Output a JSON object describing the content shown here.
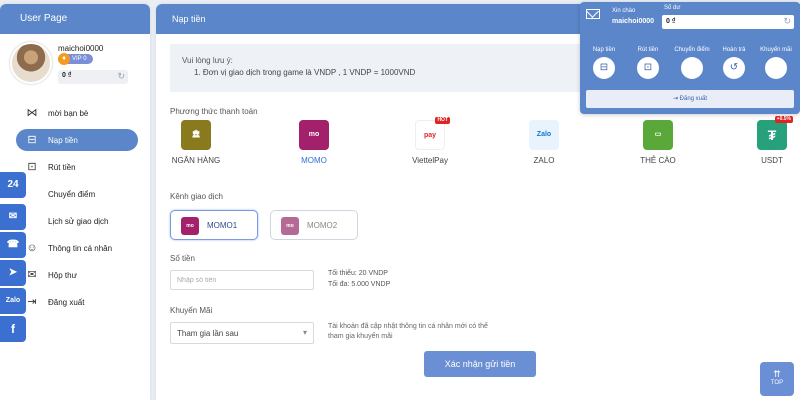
{
  "sidebar": {
    "title": "User Page",
    "username": "maichoi0000",
    "vip_label": "VIP 0",
    "balance": "0 ₫",
    "menu": [
      {
        "label": "mời bạn bè",
        "icon": "share-icon"
      },
      {
        "label": "Nạp tiền",
        "icon": "deposit-icon"
      },
      {
        "label": "Rút tiền",
        "icon": "withdraw-icon"
      },
      {
        "label": "Chuyển điểm",
        "icon": "transfer-icon"
      },
      {
        "label": "Lịch sử giao dịch",
        "icon": "history-icon"
      },
      {
        "label": "Thông tin cá nhân",
        "icon": "user-icon"
      },
      {
        "label": "Hộp thư",
        "icon": "mailbox-icon"
      },
      {
        "label": "Đăng xuất",
        "icon": "logout-icon"
      }
    ],
    "active_index": 1
  },
  "social": [
    {
      "label": "24",
      "icon": "support-24h-icon"
    },
    {
      "label": "✉",
      "icon": "mail-icon"
    },
    {
      "label": "☎",
      "icon": "phone-icon"
    },
    {
      "label": "➤",
      "icon": "telegram-icon"
    },
    {
      "label": "Zalo",
      "icon": "zalo-icon"
    },
    {
      "label": "f",
      "icon": "facebook-icon"
    }
  ],
  "main": {
    "title": "Nạp tiền",
    "notice_title": "Vui lòng lưu ý:",
    "notice_line": "1. Đơn vị giao dịch trong game là VNDP , 1 VNDP = 1000VND",
    "payment_label": "Phương thức thanh toán",
    "payment_methods": [
      {
        "label": "NGÂN HÀNG",
        "logo": "bank-icon",
        "color": "#8a7a1e"
      },
      {
        "label": "MOMO",
        "logo": "momo-icon",
        "color": "#a3206b",
        "selected": true
      },
      {
        "label": "ViettelPay",
        "logo": "viettelpay-icon",
        "color": "#e02424",
        "tag": "HOT"
      },
      {
        "label": "ZALO",
        "logo": "zalopay-icon",
        "color": "#0a7ad6"
      },
      {
        "label": "THẺ CÀO",
        "logo": "card-icon",
        "color": "#5aa83a"
      },
      {
        "label": "USDT",
        "logo": "usdt-icon",
        "color": "#26a17b",
        "tag": "+0.5%"
      }
    ],
    "channel_label": "Kênh giao dịch",
    "channels": [
      {
        "label": "MOMO1",
        "selected": true
      },
      {
        "label": "MOMO2",
        "selected": false
      }
    ],
    "amount_label": "Số tiền",
    "amount_placeholder": "Nhập số tiền",
    "min_text": "Tối thiểu:  20 VNDP",
    "max_text": "Tối đa:  5.000 VNDP",
    "promo_label": "Khuyến Mãi",
    "promo_value": "Tham gia lần sau",
    "promo_note": "Tài khoản đã cập nhật thông tin cá nhân mới có thể tham gia khuyến mãi",
    "submit_label": "Xác nhận gửi tiền"
  },
  "account_card": {
    "greeting": "Xin chào",
    "username": "maichoi0000",
    "balance_label": "Số dư",
    "balance": "0 ₫",
    "quick_actions": [
      {
        "label": "Nạp tiền",
        "icon": "deposit-icon"
      },
      {
        "label": "Rút tiền",
        "icon": "withdraw-icon"
      },
      {
        "label": "Chuyển điểm",
        "icon": "transfer-icon"
      },
      {
        "label": "Hoàn trả",
        "icon": "refund-icon"
      },
      {
        "label": "Khuyến mãi",
        "icon": "gift-icon"
      }
    ],
    "logout_label": "Đăng xuất"
  },
  "top_button": {
    "label": "TOP"
  },
  "colors": {
    "primary": "#5b86c9",
    "momo": "#a3206b",
    "social": "#3b6fd0"
  }
}
